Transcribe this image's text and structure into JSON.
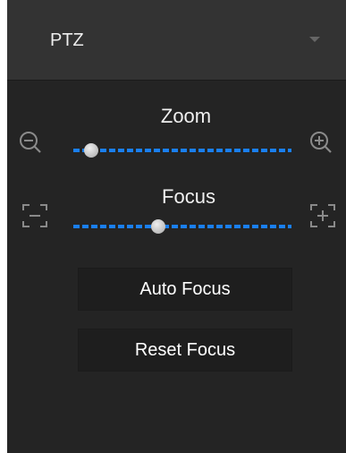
{
  "header": {
    "title": "PTZ",
    "dropdown_icon": "caret-down-icon"
  },
  "zoom": {
    "label": "Zoom",
    "decrease_icon": "zoom-out-icon",
    "increase_icon": "zoom-in-icon",
    "level_percent": 8
  },
  "focus": {
    "label": "Focus",
    "near_icon": "focus-near-icon",
    "far_icon": "focus-far-icon",
    "level_percent": 39
  },
  "buttons": {
    "auto_focus": "Auto Focus",
    "reset_focus": "Reset Focus"
  },
  "colors": {
    "panel_background": "#242424",
    "header_background": "#333333",
    "slider_accent": "#1a7ff2",
    "button_background": "#1e1e1e"
  }
}
